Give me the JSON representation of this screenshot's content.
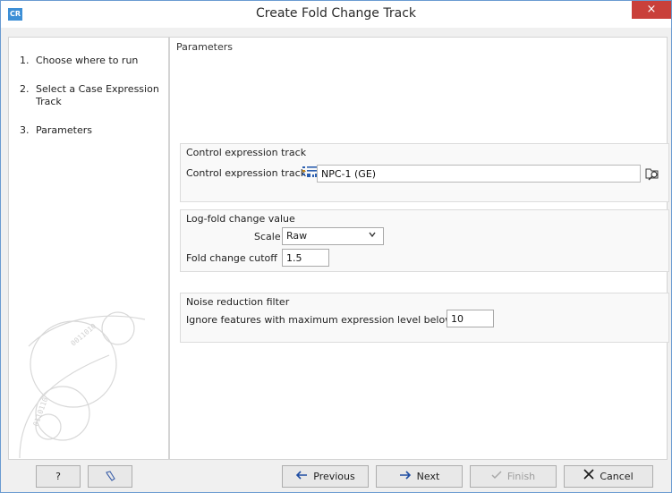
{
  "window": {
    "app_icon_text": "CR",
    "title": "Create Fold Change Track",
    "close_label": "×"
  },
  "steps": [
    {
      "num": "1.",
      "label": "Choose where to run"
    },
    {
      "num": "2.",
      "label": "Select a Case Expression Track"
    },
    {
      "num": "3.",
      "label": "Parameters"
    }
  ],
  "main": {
    "heading": "Parameters",
    "control_group": {
      "title": "Control expression track",
      "field_label": "Control expression track",
      "value": "NPC-1 (GE)"
    },
    "logfold_group": {
      "title": "Log-fold change value",
      "scale_label": "Scale",
      "scale_value": "Raw",
      "cutoff_label": "Fold change cutoff",
      "cutoff_value": "1.5"
    },
    "noise_group": {
      "title": "Noise reduction filter",
      "ignore_label": "Ignore features with maximum expression level below",
      "ignore_value": "10"
    }
  },
  "footer": {
    "help_label": "?",
    "previous_label": "Previous",
    "next_label": "Next",
    "finish_label": "Finish",
    "cancel_label": "Cancel"
  },
  "colors": {
    "accent": "#3d8fd6",
    "close": "#c9403a",
    "arrow": "#1f4ea3",
    "cancel_x": "#1a1a1a"
  }
}
